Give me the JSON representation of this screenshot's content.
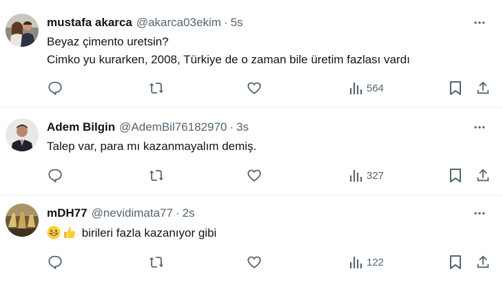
{
  "tweets": [
    {
      "name": "mustafa akarca",
      "handle": "@akarca03ekim",
      "separator": "·",
      "time": "5s",
      "lines": [
        "Beyaz çimento uretsin?",
        "Cimko yu kurarken, 2008, Türkiye de o zaman bile üretim fazlası vardı"
      ],
      "views": "564"
    },
    {
      "name": "Adem Bilgin",
      "handle": "@AdemBil76182970",
      "separator": "·",
      "time": "3s",
      "lines": [
        "Talep var, para mı kazanmayalım demiş."
      ],
      "views": "327"
    },
    {
      "name": "mDH77",
      "handle": "@nevidimata77",
      "separator": "·",
      "time": "2s",
      "lines": [
        "birileri fazla kazanıyor gibi"
      ],
      "views": "122"
    }
  ],
  "icons": {
    "reply": "reply-icon",
    "retweet": "retweet-icon",
    "like": "heart-icon",
    "views": "views-icon",
    "bookmark": "bookmark-icon",
    "share": "share-icon",
    "more": "more-icon"
  },
  "colors": {
    "text": "#0f1419",
    "secondary": "#536471",
    "divider": "#eff3f4"
  }
}
